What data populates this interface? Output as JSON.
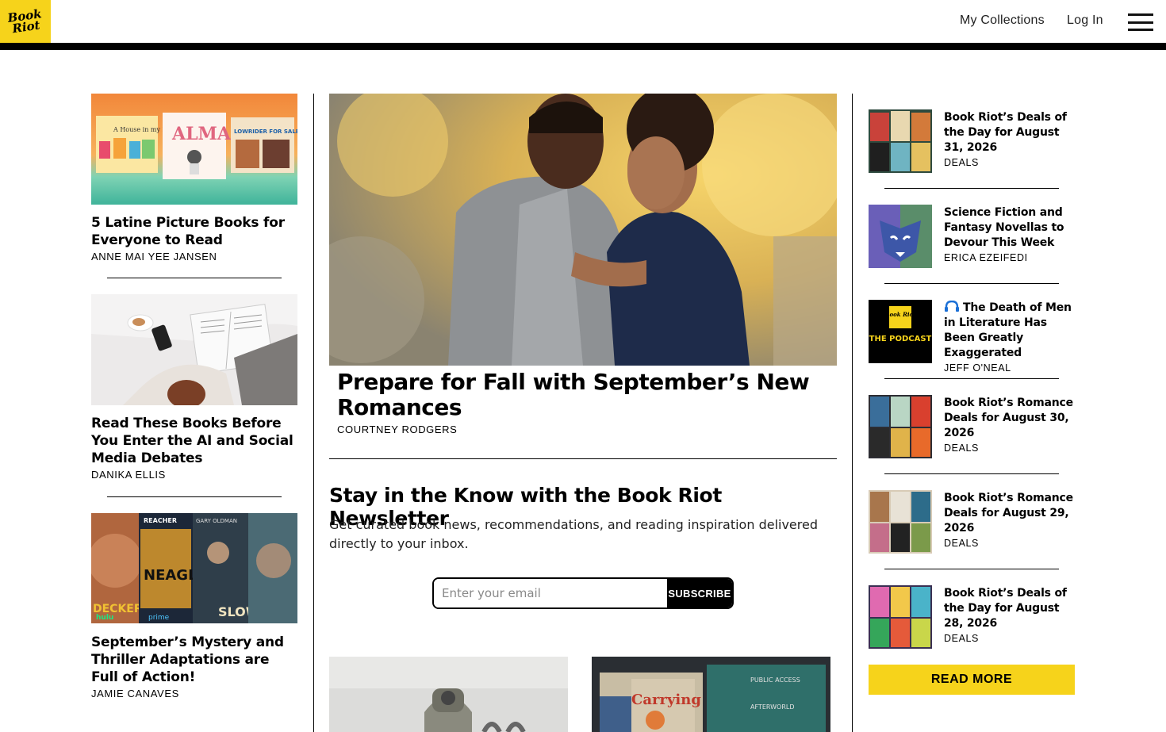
{
  "header": {
    "logo_text": "Book Riot",
    "nav": {
      "collections": "My Collections",
      "login": "Log In"
    }
  },
  "left_column": [
    {
      "title": "5 Latine Picture Books for Everyone to Read",
      "author": "ANNE MAI YEE JANSEN",
      "cover_texts": [
        "A House in my Barrio",
        "ALMA",
        "LOWRIDER FOR SALE"
      ]
    },
    {
      "title": "Read These Books Before You Enter the AI and Social Media Debates",
      "author": "DANIKA ELLIS"
    },
    {
      "title": "September’s Mystery and Thriller Adaptations are Full of Action!",
      "author": "JAMIE CANAVES",
      "poster_texts": [
        "REACHER",
        "GARY OLDMAN",
        "NEAGLEY",
        "DECKER",
        "hulu",
        "prime",
        "SLOW HORSES"
      ]
    }
  ],
  "featured": {
    "title": "Prepare for Fall with September’s New Romances",
    "author": "COURTNEY RODGERS"
  },
  "newsletter": {
    "title": "Stay in the Know with the Book Riot Newsletter",
    "description": "Get curated book news, recommendations, and reading inspiration delivered directly to your inbox.",
    "placeholder": "Enter your email",
    "button": "SUBSCRIBE"
  },
  "bottom_covers": [
    "Carrying",
    "PUBLIC ACCESS",
    "AFTERWORLD"
  ],
  "sidebar": [
    {
      "title": "Book Riot’s Deals of the Day for August 31, 2026",
      "meta": "DEALS"
    },
    {
      "title": "Science Fiction and Fantasy Novellas to Devour This Week",
      "meta": "ERICA EZEIFEDI"
    },
    {
      "title": "The Death of Men in Literature Has Been Greatly Exaggerated",
      "meta": "JEFF O'NEAL",
      "icon": "headphones-icon",
      "thumb_text": "Book Riot",
      "thumb_label": "THE PODCAST"
    },
    {
      "title": "Book Riot’s Romance Deals for August 30, 2026",
      "meta": "DEALS"
    },
    {
      "title": "Book Riot’s Romance Deals for August 29, 2026",
      "meta": "DEALS"
    },
    {
      "title": "Book Riot’s Deals of the Day for August 28, 2026",
      "meta": "DEALS"
    }
  ],
  "read_more": "READ MORE",
  "colors": {
    "brand_yellow": "#f6d31b",
    "black": "#000000"
  }
}
